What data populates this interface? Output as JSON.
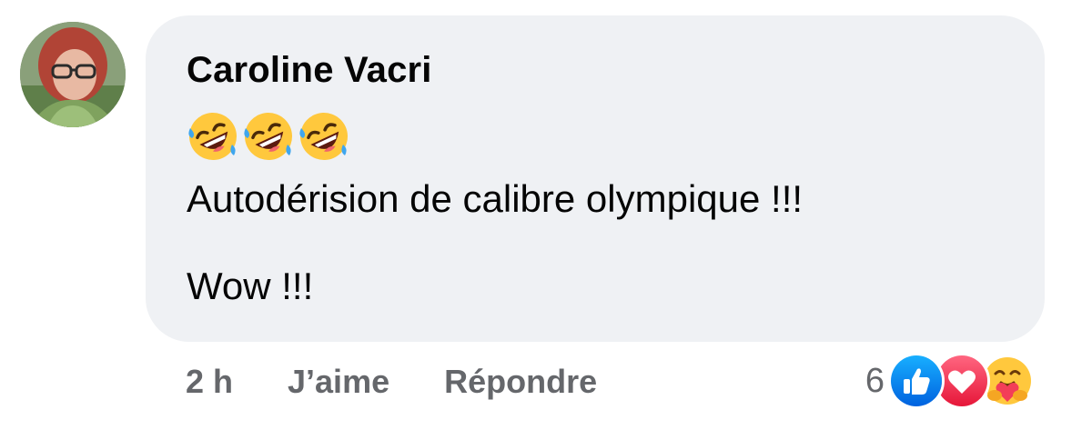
{
  "comment": {
    "author": "Caroline Vacri",
    "emoji_icons": [
      "rolling-on-floor-laughing-icon",
      "rolling-on-floor-laughing-icon",
      "rolling-on-floor-laughing-icon"
    ],
    "text_line1": "Autodérision de calibre olympique !!!",
    "text_line2": "Wow !!!"
  },
  "actions": {
    "time": "2 h",
    "like_label": "J’aime",
    "reply_label": "Répondre"
  },
  "reactions": {
    "count": "6",
    "icons": [
      "like-icon",
      "love-icon",
      "care-icon"
    ]
  },
  "colors": {
    "bubble": "#eff1f4",
    "text": "#050505",
    "secondary": "#65676b",
    "like_blue": "#1877f2",
    "love_red": "#f33e58"
  }
}
